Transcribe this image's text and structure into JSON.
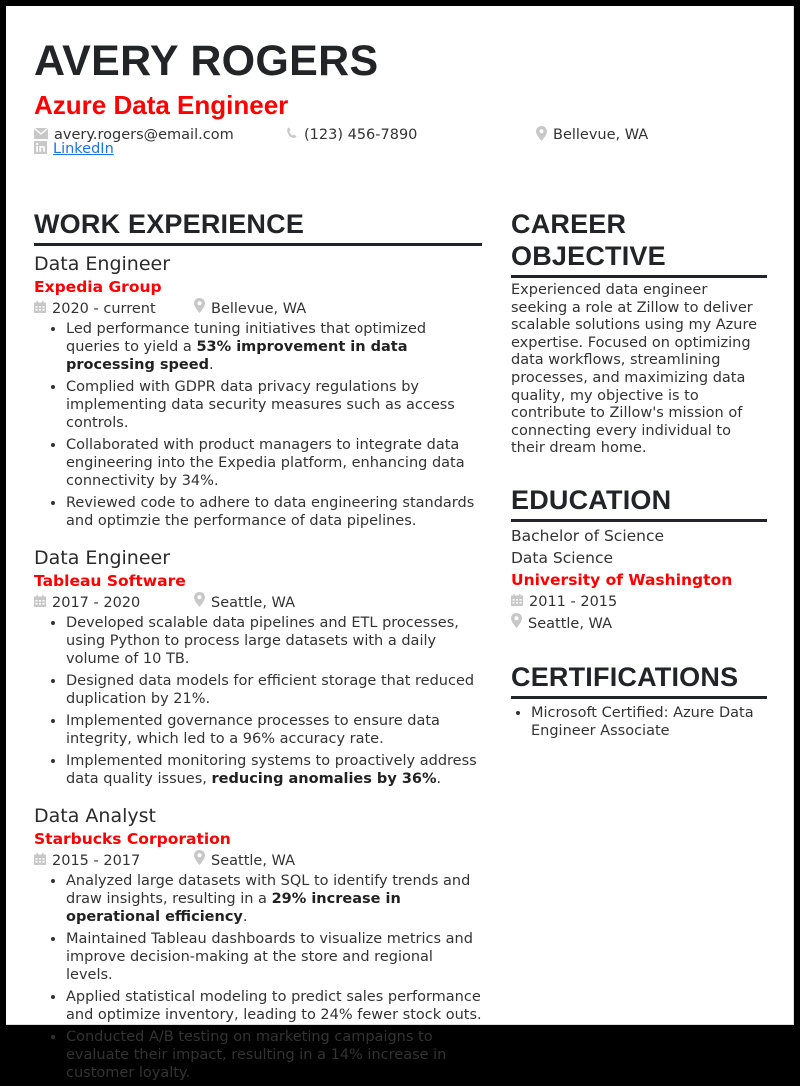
{
  "header": {
    "name": "AVERY ROGERS",
    "headline": "Azure Data Engineer",
    "contact": {
      "email": {
        "icon": "envelope-icon",
        "value": "avery.rogers@email.com"
      },
      "phone": {
        "icon": "phone-icon",
        "value": "(123) 456-7890"
      },
      "location": {
        "icon": "map-pin-icon",
        "value": "Bellevue, WA"
      },
      "linkedin": {
        "icon": "linkedin-icon",
        "value": "LinkedIn"
      }
    }
  },
  "colors": {
    "accent": "#ff0000",
    "heading": "#222428",
    "link": "#1a73e8",
    "icon": "#c2c2c2"
  },
  "work_experience": {
    "title": "WORK EXPERIENCE",
    "jobs": [
      {
        "title": "Data Engineer",
        "company": "Expedia Group",
        "dates": "2020 - current",
        "location": "Bellevue, WA",
        "bullets": [
          {
            "pre": "Led performance tuning initiatives that optimized queries to yield a ",
            "bold": "53% improvement in data processing speed",
            "post": "."
          },
          {
            "pre": "Complied with GDPR data privacy regulations by implementing data security measures such as access controls.",
            "bold": "",
            "post": ""
          },
          {
            "pre": "Collaborated with product managers to integrate data engineering into the Expedia platform, enhancing data connectivity by 34%.",
            "bold": "",
            "post": ""
          },
          {
            "pre": "Reviewed code to adhere to data engineering standards and optimzie the performance of data pipelines.",
            "bold": "",
            "post": ""
          }
        ]
      },
      {
        "title": "Data Engineer",
        "company": "Tableau Software",
        "dates": "2017 - 2020",
        "location": "Seattle, WA",
        "bullets": [
          {
            "pre": "Developed scalable data pipelines and ETL processes, using Python to process large datasets with a daily volume of 10 TB.",
            "bold": "",
            "post": ""
          },
          {
            "pre": "Designed data models for efficient storage that reduced duplication by 21%.",
            "bold": "",
            "post": ""
          },
          {
            "pre": "Implemented governance processes to ensure data integrity, which led to a 96% accuracy rate.",
            "bold": "",
            "post": ""
          },
          {
            "pre": "Implemented monitoring systems to proactively address data quality issues, ",
            "bold": "reducing anomalies by 36%",
            "post": "."
          }
        ]
      },
      {
        "title": "Data Analyst",
        "company": "Starbucks Corporation",
        "dates": "2015 - 2017",
        "location": "Seattle, WA",
        "bullets": [
          {
            "pre": "Analyzed large datasets with SQL to identify trends and draw insights, resulting in a ",
            "bold": "29% increase in operational efficiency",
            "post": "."
          },
          {
            "pre": "Maintained Tableau dashboards to visualize metrics and improve decision-making at the store and regional levels.",
            "bold": "",
            "post": ""
          },
          {
            "pre": "Applied statistical modeling to predict sales performance and optimize inventory, leading to 24% fewer stock outs.",
            "bold": "",
            "post": ""
          },
          {
            "pre": "Conducted A/B testing on marketing campaigns to evaluate their impact, resulting in a 14% increase in customer loyalty.",
            "bold": "",
            "post": ""
          }
        ]
      }
    ]
  },
  "career_objective": {
    "title_line1": "CAREER",
    "title_line2": "OBJECTIVE",
    "text": "Experienced data engineer seeking a role at Zillow to deliver scalable solutions using my Azure expertise. Focused on optimizing data workflows, streamlining processes, and maximizing data quality, my objective is to contribute to Zillow's mission of connecting every individual to their dream home."
  },
  "education": {
    "title": "EDUCATION",
    "degree": "Bachelor of Science",
    "field": "Data Science",
    "school": "University of Washington",
    "dates": "2011 - 2015",
    "location": "Seattle, WA"
  },
  "certifications": {
    "title": "CERTIFICATIONS",
    "items": [
      "Microsoft Certified: Azure Data Engineer Associate"
    ]
  }
}
